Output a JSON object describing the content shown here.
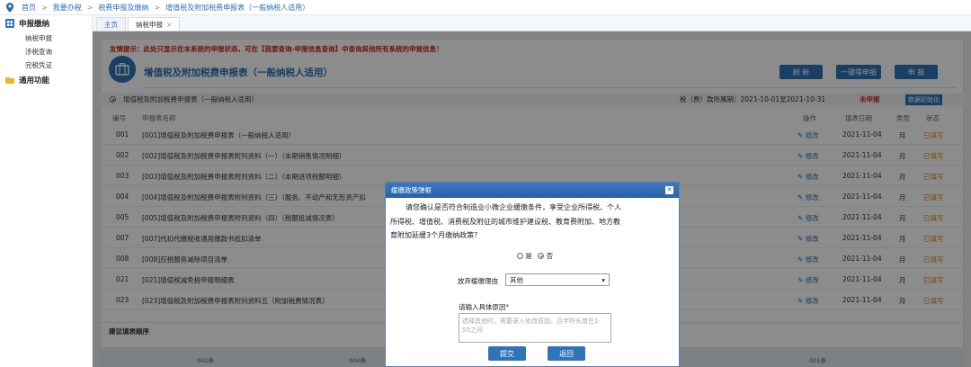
{
  "breadcrumb": [
    "首页",
    "我要办税",
    "税费申报及缴纳",
    "增值税及附加税费申报表（一般纳税人适用）"
  ],
  "sidebar": {
    "sections": [
      {
        "label": "申报缴纳",
        "items": [
          "纳税申报",
          "涉税查询",
          "完税凭证"
        ]
      },
      {
        "label": "通用功能",
        "items": []
      }
    ]
  },
  "tabs": [
    {
      "label": "主页"
    },
    {
      "label": "纳税申报",
      "close": "×"
    }
  ],
  "tip": "友情提示：此处只显示在本系统的申报状态，可在【我要查询-申报信息查询】中查询其他所有系统的申报信息！",
  "header": {
    "title": "增值税及附加税费申报表（一般纳税人适用）",
    "refresh": "刷 新",
    "zero_declare": "一键零申报",
    "declare": "申 报"
  },
  "subheader": {
    "form_name": "增值税及附加税费申报表（一般纳税人适用）",
    "period": "税（费）款所属期：2021-10-01至2021-10-31",
    "status": "未申报",
    "init_button": "数据初始化"
  },
  "table": {
    "columns": [
      "编号",
      "申报表名称",
      "操作",
      "填表日期",
      "类型",
      "状态"
    ],
    "rows": [
      {
        "id": "001",
        "name": "[001]增值税及附加税费申报表（一般纳税人适用）",
        "action": "修改",
        "date": "2021-11-04",
        "type": "月",
        "status": "已填写"
      },
      {
        "id": "002",
        "name": "[002]增值税及附加税费申报表附列资料（一）（本期销售情况明细）",
        "action": "修改",
        "date": "2021-11-04",
        "type": "月",
        "status": "已填写"
      },
      {
        "id": "003",
        "name": "[003]增值税及附加税费申报表附列资料（二）（本期进项税额明细）",
        "action": "修改",
        "date": "2021-11-04",
        "type": "月",
        "status": "已填写"
      },
      {
        "id": "004",
        "name": "[004]增值税及附加税费申报表附列资料（三）（服务、不动产和无形资产扣",
        "action": "修改",
        "date": "2021-11-04",
        "type": "月",
        "status": "已填写"
      },
      {
        "id": "005",
        "name": "[005]增值税及附加税费申报表附列资料（四）（税额抵减情况表）",
        "action": "修改",
        "date": "2021-11-04",
        "type": "月",
        "status": "已填写"
      },
      {
        "id": "007",
        "name": "[007]代扣代缴税收通用缴款书抵扣清单",
        "action": "修改",
        "date": "2021-11-04",
        "type": "月",
        "status": "已填写"
      },
      {
        "id": "008",
        "name": "[008]应税服务减除项目清单",
        "action": "修改",
        "date": "2021-11-04",
        "type": "月",
        "status": "已填写"
      },
      {
        "id": "021",
        "name": "[021]增值税减免税申报明细表",
        "action": "修改",
        "date": "2021-11-04",
        "type": "月",
        "status": "已填写"
      },
      {
        "id": "023",
        "name": "[023]增值税及附加税费申报表附列资料五（附加税费情况表）",
        "action": "修改",
        "date": "2021-11-04",
        "type": "月",
        "status": "已填写"
      }
    ]
  },
  "suggest": "建议填表顺序",
  "flow": [
    "002表",
    "004表",
    "001表"
  ],
  "dialog": {
    "title": "缓缴政策弹框",
    "line1": "请您确认是否符合制造业小微企业缓缴条件，享受企业所得税、个人",
    "line2": "所得税、增值税、消费税及附征的城市维护建设税、教育费附加、地方教",
    "line3": "育附加延缓3个月缴纳政策？",
    "yes": "是",
    "no": "否",
    "reason_label": "放弃缓缴理由",
    "reason_value": "其他",
    "input_label": "请输入具体原因",
    "required_mark": "*",
    "placeholder": "选择其他时，需要录入修改原因，且字符长度在1-50之间",
    "submit": "提交",
    "back": "返回"
  },
  "colors": {
    "primary": "#2f73b8",
    "warning": "#c8261a",
    "filled": "#e0891a"
  }
}
